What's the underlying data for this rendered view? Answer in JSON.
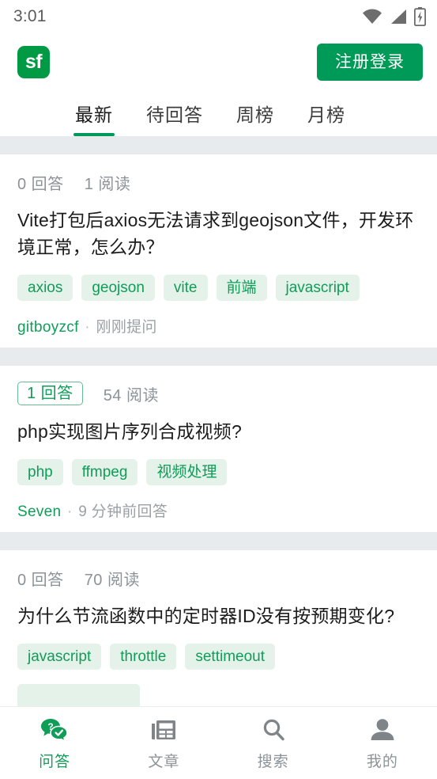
{
  "status_bar": {
    "time": "3:01",
    "icons": [
      "wifi-icon",
      "cell-signal-icon",
      "battery-charging-icon"
    ]
  },
  "header": {
    "logo_text": "sf",
    "logo_name": "segmentfault-logo",
    "login_label": "注册登录"
  },
  "colors": {
    "brand_green": "#009a58",
    "logo_green": "#009a44",
    "tag_bg": "#e4f2ea",
    "tag_text": "#0f9d58",
    "divider": "#e8ebee",
    "muted_text": "#8b9398"
  },
  "tabs": [
    {
      "label": "最新",
      "active": true
    },
    {
      "label": "待回答",
      "active": false
    },
    {
      "label": "周榜",
      "active": false
    },
    {
      "label": "月榜",
      "active": false
    }
  ],
  "posts": [
    {
      "answers": "0 回答",
      "answers_highlighted": false,
      "views": "1 阅读",
      "title": "Vite打包后axios无法请求到geojson文件，开发环境正常，怎么办？",
      "tags": [
        "axios",
        "geojson",
        "vite",
        "前端",
        "javascript"
      ],
      "author": "gitboyzcf",
      "separator": "·",
      "time": "刚刚提问"
    },
    {
      "answers": "1 回答",
      "answers_highlighted": true,
      "views": "54 阅读",
      "title": "php实现图片序列合成视频?",
      "tags": [
        "php",
        "ffmpeg",
        "视频处理"
      ],
      "author": "Seven",
      "separator": "·",
      "time": "9 分钟前回答"
    },
    {
      "answers": "0 回答",
      "answers_highlighted": false,
      "views": "70 阅读",
      "title": "为什么节流函数中的定时器ID没有按预期变化?",
      "tags": [
        "javascript",
        "throttle",
        "settimeout"
      ],
      "author": "",
      "separator": "",
      "time": ""
    }
  ],
  "bottom_nav": [
    {
      "label": "问答",
      "icon": "qa-bubbles-icon",
      "active": true
    },
    {
      "label": "文章",
      "icon": "newspaper-icon",
      "active": false
    },
    {
      "label": "搜索",
      "icon": "search-icon",
      "active": false
    },
    {
      "label": "我的",
      "icon": "person-icon",
      "active": false
    }
  ]
}
